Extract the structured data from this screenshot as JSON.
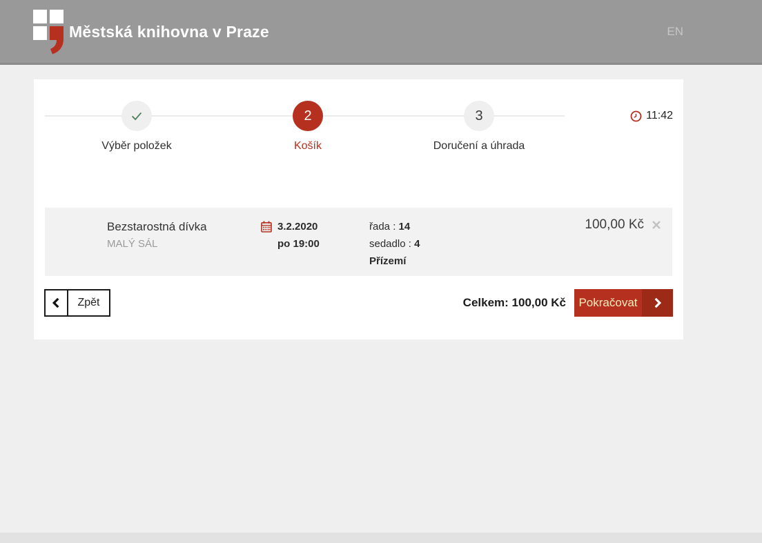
{
  "colors": {
    "header_gray": "#999999",
    "page_bg": "#efefef",
    "accent_red": "#b5301f",
    "accent_red_dark": "#9c2a17",
    "success_green": "#4e7e5d",
    "row_bg": "#f2f2f2",
    "continue_text": "#f7edbb"
  },
  "header": {
    "title": "Městská knihovna v Praze",
    "language_label": "EN"
  },
  "stepper": {
    "timer": "11:42",
    "steps": [
      {
        "label": "Výběr položek",
        "indicator": "✓",
        "state": "completed"
      },
      {
        "label": "Košík",
        "indicator": "2",
        "state": "active"
      },
      {
        "label": "Doručení a úhrada",
        "indicator": "3",
        "state": "upcoming"
      }
    ]
  },
  "cart": {
    "item": {
      "title": "Bezstarostná dívka",
      "venue": "MALÝ SÁL",
      "date": "3.2.2020",
      "time": "po 19:00",
      "row_label": "řada :",
      "row_value": "14",
      "seat_label": "sedadlo :",
      "seat_value": "4",
      "section": "Přízemí",
      "price": "100,00 Kč"
    }
  },
  "actions": {
    "back_label": "Zpět",
    "total": "Celkem: 100,00 Kč",
    "continue_label": "Pokračovat"
  }
}
